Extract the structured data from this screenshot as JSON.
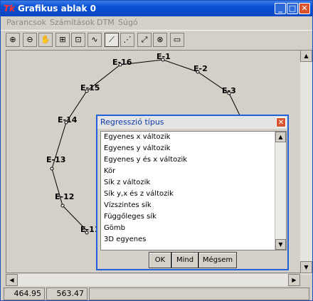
{
  "window": {
    "title": "Grafikus ablak 0",
    "app_icon": "Tk"
  },
  "menu": [
    "Parancsok",
    "Számítások",
    "DTM",
    "Súgó"
  ],
  "toolbar_icons": [
    "zoom-in-icon",
    "zoom-out-icon",
    "pan-hand-icon",
    "zoom-window-icon",
    "zoom-extents-icon",
    "draw-line-icon",
    "line-select-icon",
    "point-select-icon",
    "scale-icon",
    "rotate-icon",
    "rectangle-icon"
  ],
  "points": [
    "E-1",
    "E-2",
    "E-3",
    "E-11",
    "E-12",
    "E-13",
    "E-14",
    "E-15",
    "E-16"
  ],
  "status": {
    "x": "464.95",
    "y": "563.47"
  },
  "dialog": {
    "title": "Regresszió típus",
    "items": [
      "Egyenes x változik",
      "Egyenes y változik",
      "Egyenes y és x változik",
      "Kör",
      "Sík z változik",
      "Sík y,x és z változik",
      "Vízszintes sík",
      "Függőleges sík",
      "Gömb",
      "3D egyenes"
    ],
    "buttons": {
      "ok": "OK",
      "all": "Mind",
      "cancel": "Mégsem"
    }
  }
}
